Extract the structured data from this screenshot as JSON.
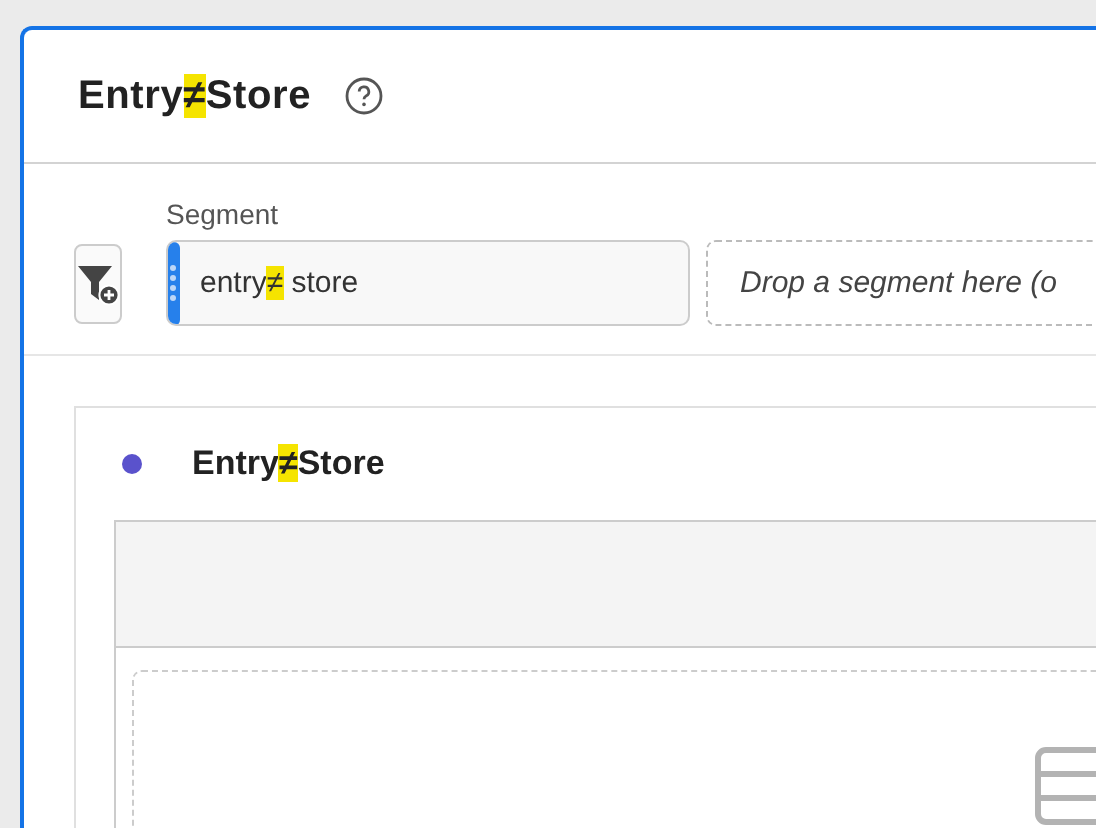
{
  "panel": {
    "title": [
      {
        "text": "Entry",
        "highlighted": false
      },
      {
        "text": "≠",
        "highlighted": true
      },
      {
        "text": "Store",
        "highlighted": false
      }
    ]
  },
  "segment_bar": {
    "label": "Segment",
    "segments": [
      {
        "kind": "chip",
        "parts": [
          {
            "text": "entry",
            "highlighted": false
          },
          {
            "text": "≠",
            "highlighted": true
          },
          {
            "text": " store",
            "highlighted": false
          }
        ]
      },
      {
        "kind": "dropzone",
        "placeholder": "Drop a segment here (o"
      }
    ]
  },
  "visualization": {
    "color": "#5a52cc",
    "title": [
      {
        "text": "Entry",
        "highlighted": false
      },
      {
        "text": "≠",
        "highlighted": true
      },
      {
        "text": "Store",
        "highlighted": false
      }
    ]
  }
}
